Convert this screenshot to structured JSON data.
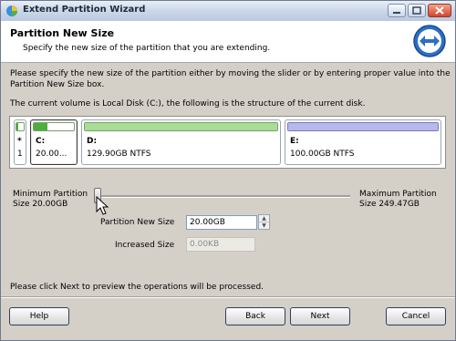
{
  "window": {
    "title": "Extend Partition Wizard"
  },
  "header": {
    "title": "Partition New Size",
    "subtitle": "Specify the new size of the partition that you are extending."
  },
  "instructions": {
    "line1": "Please specify the new size of the partition either by moving the slider or by entering proper value into the",
    "line2": "Partition New Size box.",
    "structure": "The current volume is Local Disk (C:), the following is the structure of the current disk."
  },
  "disk": {
    "partitions": [
      {
        "letter": "*",
        "info": "1",
        "used_fraction": 0.3,
        "color": "#4caf3c"
      },
      {
        "letter": "C:",
        "info": "20.00...",
        "used_fraction": 0.35,
        "color": "#4caf3c"
      },
      {
        "letter": "D:",
        "info": "129.90GB NTFS",
        "used_fraction": 1.0,
        "color": "#a8dd96"
      },
      {
        "letter": "E:",
        "info": "100.00GB NTFS",
        "used_fraction": 1.0,
        "color": "#b6b8ee"
      }
    ]
  },
  "slider": {
    "min_label": "Minimum Partition",
    "min_value": "Size 20.00GB",
    "max_label": "Maximum Partition",
    "max_value": "Size 249.47GB",
    "position_fraction": 0.0
  },
  "fields": {
    "new_size_label": "Partition New Size",
    "new_size_value": "20.00GB",
    "increased_label": "Increased Size",
    "increased_value": "0.00KB"
  },
  "footer_text": "Please click Next to preview the operations will be processed.",
  "buttons": {
    "help": "Help",
    "back": "Back",
    "next": "Next",
    "cancel": "Cancel"
  },
  "colors": {
    "primary_used": "#4caf3c",
    "primary_light": "#a8dd96",
    "logical": "#b6b8ee",
    "window_bg": "#d4d0c8"
  }
}
